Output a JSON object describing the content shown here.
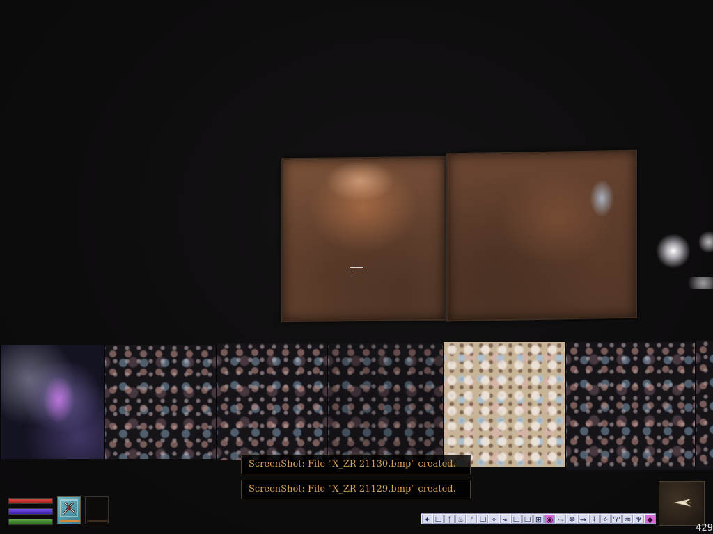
{
  "messages": [
    "ScreenShot: File \"X_ZR 21130.bmp\" created.",
    "ScreenShot: File \"X_ZR 21129.bmp\" created."
  ],
  "hud": {
    "health": 1.0,
    "magicka": 1.0,
    "fatigue": 1.0,
    "weapon_icon": "crossed-weapon-icon",
    "spell_slot": "empty",
    "effects_count": 22,
    "compass_needle": "arrow-icon",
    "fps": "429"
  },
  "colors": {
    "message_text": "#d8a055",
    "health": "#c23333",
    "magicka": "#5a3ad0",
    "fatigue": "#4a8a38",
    "effects_bar": "#f0ecf4",
    "effect_highlight": "#d86ad8"
  },
  "effects": [
    "✦",
    "☐",
    "ᛉ",
    "♨",
    "ᚠ",
    "☐",
    "✧",
    "⌁",
    "☐",
    "☐",
    "⊞",
    "◉",
    "⤳",
    "☸",
    "⇝",
    "⌇",
    "✧",
    "♈",
    "♒",
    "♆",
    "◆",
    "☐"
  ]
}
